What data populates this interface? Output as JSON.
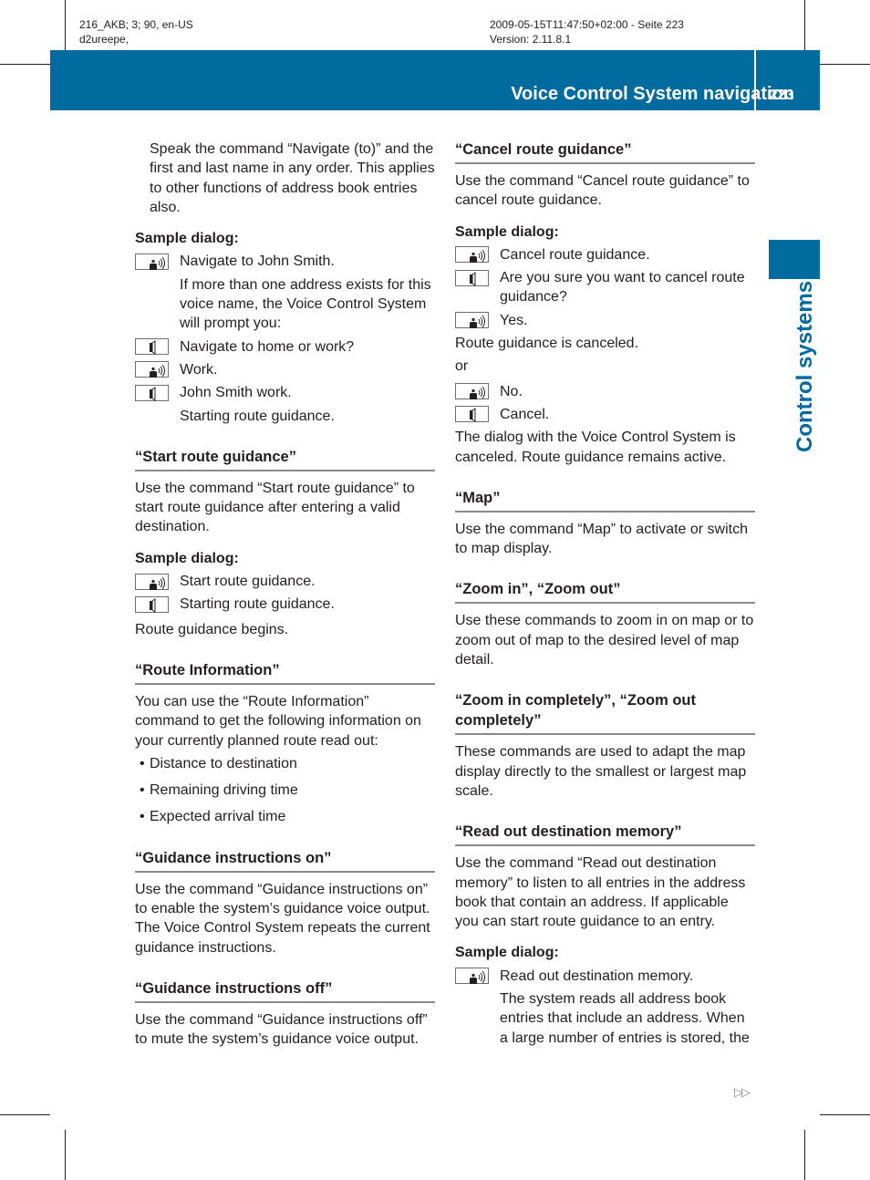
{
  "print_meta": {
    "left_line1": "216_AKB; 3; 90, en-US",
    "left_line2": "d2ureepe,",
    "right_line1": "2009-05-15T11:47:50+02:00 - Seite 223",
    "right_line2": "Version: 2.11.8.1"
  },
  "header": {
    "title": "Voice Control System navigation",
    "page_number": "223",
    "accent_color": "#006b9e"
  },
  "side_tab": {
    "label": "Control systems"
  },
  "icons": {
    "user_speaks": "speaking-person-icon",
    "system_speaks": "loudspeaker-icon",
    "continue": "double-triangle-continue-icon"
  },
  "left_column": {
    "intro": "Speak the command “Navigate (to)” and the first and last name in any order. This applies to other functions of address book entries also.",
    "dialog1": {
      "heading": "Sample dialog:",
      "lines": [
        {
          "speaker": "user",
          "text": "Navigate to John Smith."
        },
        {
          "speaker": "none",
          "text": "If more than one address exists for this voice name, the Voice Control System will prompt you:"
        },
        {
          "speaker": "system",
          "text": "Navigate to home or work?"
        },
        {
          "speaker": "user",
          "text": "Work."
        },
        {
          "speaker": "system",
          "text": "John Smith work."
        },
        {
          "speaker": "none",
          "text": "Starting route guidance."
        }
      ]
    },
    "start_route": {
      "heading": "“Start route guidance”",
      "body": "Use the command “Start route guidance” to start route guidance after entering a valid destination.",
      "dialog_heading": "Sample dialog:",
      "lines": [
        {
          "speaker": "user",
          "text": "Start route guidance."
        },
        {
          "speaker": "system",
          "text": "Starting route guidance."
        }
      ],
      "result": "Route guidance begins."
    },
    "route_info": {
      "heading": "“Route Information”",
      "body": "You can use the “Route Information” command to get the following information on your currently planned route read out:",
      "bullets": [
        "Distance to destination",
        "Remaining driving time",
        "Expected arrival time"
      ]
    },
    "guidance_on": {
      "heading": "“Guidance instructions on”",
      "body": "Use the command “Guidance instructions on” to enable the system’s guidance voice output. The Voice Control System repeats the current guidance instructions."
    },
    "guidance_off": {
      "heading": "“Guidance instructions off”",
      "body": "Use the command “Guidance instructions off” to mute the system’s guidance voice output."
    }
  },
  "right_column": {
    "cancel_route": {
      "heading": "“Cancel route guidance”",
      "body": "Use the command “Cancel route guidance” to cancel route guidance.",
      "dialog_heading": "Sample dialog:",
      "lines": [
        {
          "speaker": "user",
          "text": "Cancel route guidance."
        },
        {
          "speaker": "system",
          "text": "Are you sure you want to cancel route guidance?"
        },
        {
          "speaker": "user",
          "text": "Yes."
        }
      ],
      "result1": "Route guidance is canceled.",
      "or": "or",
      "lines2": [
        {
          "speaker": "user",
          "text": "No."
        },
        {
          "speaker": "system",
          "text": "Cancel."
        }
      ],
      "result2": "The dialog with the Voice Control System is canceled. Route guidance remains active."
    },
    "map": {
      "heading": "“Map”",
      "body": "Use the command “Map” to activate or switch to map display."
    },
    "zoom": {
      "heading": "“Zoom in”, “Zoom out”",
      "body": "Use these commands to zoom in on map or to zoom out of map to the desired level of map detail."
    },
    "zoom_complete": {
      "heading": "“Zoom in completely”, “Zoom out completely”",
      "body": "These commands are used to adapt the map display directly to the smallest or largest map scale."
    },
    "read_out": {
      "heading": "“Read out destination memory”",
      "body": "Use the command “Read out destination memory” to listen to all entries in the address book that contain an address. If applicable you can start route guidance to an entry.",
      "dialog_heading": "Sample dialog:",
      "lines": [
        {
          "speaker": "user",
          "text": "Read out destination memory."
        },
        {
          "speaker": "none",
          "text": "The system reads all address book entries that include an address. When a large number of entries is stored, the"
        }
      ]
    }
  },
  "footer": {
    "continue_symbol": "▷▷"
  }
}
